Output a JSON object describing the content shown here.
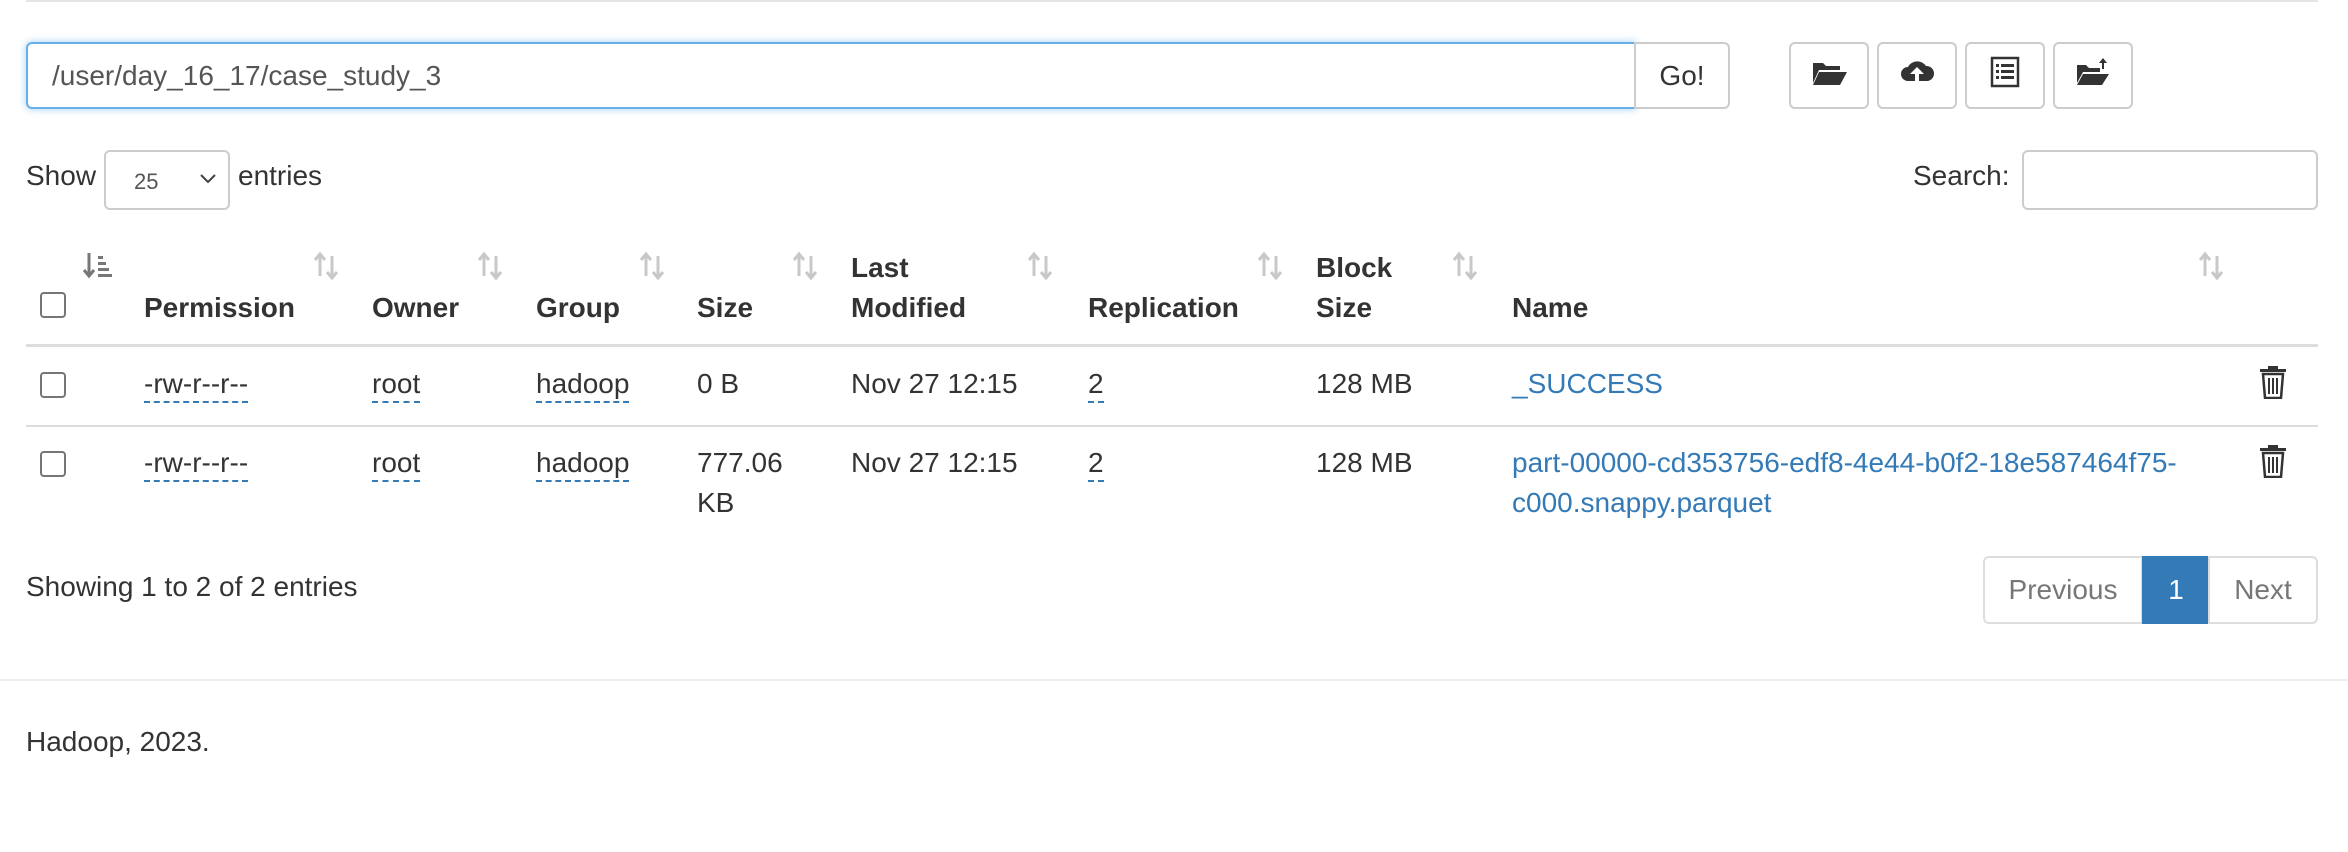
{
  "path_bar": {
    "value": "/user/day_16_17/case_study_3",
    "go_label": "Go!"
  },
  "toolbar": {
    "icons": [
      "folder-open-icon",
      "cloud-upload-icon",
      "list-alt-icon",
      "move-folder-icon"
    ]
  },
  "length_menu": {
    "show_label": "Show",
    "selected": "25",
    "entries_label": "entries"
  },
  "search": {
    "label": "Search:",
    "value": ""
  },
  "table": {
    "columns": {
      "permission": "Permission",
      "owner": "Owner",
      "group": "Group",
      "size": "Size",
      "last_modified_1": "Last",
      "last_modified_2": "Modified",
      "replication": "Replication",
      "block_size_1": "Block",
      "block_size_2": "Size",
      "name": "Name"
    },
    "rows": [
      {
        "permission": "-rw-r--r--",
        "owner": "root",
        "group": "hadoop",
        "size": "0 B",
        "size_2": "",
        "last_modified": "Nov 27 12:15",
        "replication": "2",
        "block_size": "128 MB",
        "name": "_SUCCESS",
        "name_2": ""
      },
      {
        "permission": "-rw-r--r--",
        "owner": "root",
        "group": "hadoop",
        "size": "777.06",
        "size_2": "KB",
        "last_modified": "Nov 27 12:15",
        "replication": "2",
        "block_size": "128 MB",
        "name": "part-00000-cd353756-edf8-4e44-b0f2-18e587464f75-",
        "name_2": "c000.snappy.parquet"
      }
    ]
  },
  "info": "Showing 1 to 2 of 2 entries",
  "pagination": {
    "previous": "Previous",
    "current": "1",
    "next": "Next"
  },
  "footer": "Hadoop, 2023.",
  "colors": {
    "link": "#337ab7",
    "active_page": "#337ab7",
    "focus_border": "#66afe9"
  }
}
